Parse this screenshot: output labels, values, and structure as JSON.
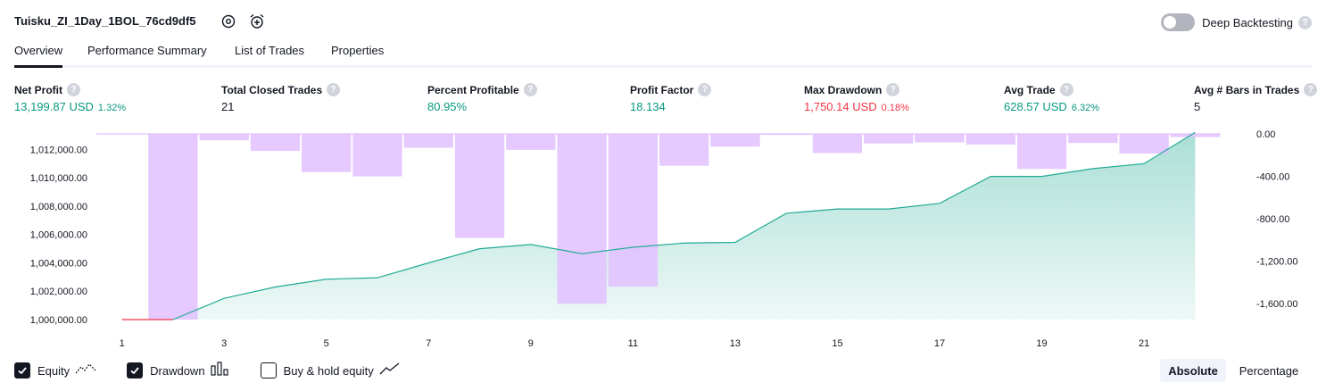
{
  "header": {
    "title": "Tuisku_ZI_1Day_1BOL_76cd9df5",
    "deep_backtesting_label": "Deep Backtesting",
    "help_mark": "?"
  },
  "tabs": [
    {
      "label": "Overview",
      "active": true
    },
    {
      "label": "Performance Summary",
      "active": false
    },
    {
      "label": "List of Trades",
      "active": false
    },
    {
      "label": "Properties",
      "active": false
    }
  ],
  "metrics": [
    {
      "label": "Net Profit",
      "value": "13,199.87 USD",
      "pct": "1.32%",
      "tone": "pos"
    },
    {
      "label": "Total Closed Trades",
      "value": "21",
      "pct": "",
      "tone": "neutral"
    },
    {
      "label": "Percent Profitable",
      "value": "80.95%",
      "pct": "",
      "tone": "pos"
    },
    {
      "label": "Profit Factor",
      "value": "18.134",
      "pct": "",
      "tone": "pos"
    },
    {
      "label": "Max Drawdown",
      "value": "1,750.14 USD",
      "pct": "0.18%",
      "tone": "neg"
    },
    {
      "label": "Avg Trade",
      "value": "628.57 USD",
      "pct": "6.32%",
      "tone": "pos"
    },
    {
      "label": "Avg # Bars in Trades",
      "value": "5",
      "pct": "",
      "tone": "neutral"
    }
  ],
  "legend": {
    "equity_label": "Equity",
    "drawdown_label": "Drawdown",
    "buyhold_label": "Buy & hold equity",
    "equity_checked": true,
    "drawdown_checked": true,
    "buyhold_checked": false
  },
  "modes": {
    "absolute": "Absolute",
    "percentage": "Percentage"
  },
  "colors": {
    "equity_line": "#22ab94",
    "equity_fill": "#22ab94",
    "drawdown_bar": "#e1c2ff",
    "initial_segment": "#f23645",
    "positive": "#089981",
    "negative": "#f23645"
  },
  "chart_data": {
    "type": "line",
    "x": [
      1,
      2,
      3,
      4,
      5,
      6,
      7,
      8,
      9,
      10,
      11,
      12,
      13,
      14,
      15,
      16,
      17,
      18,
      19,
      20,
      21,
      22
    ],
    "x_ticks": [
      "1",
      "3",
      "5",
      "7",
      "9",
      "11",
      "13",
      "15",
      "17",
      "19",
      "21"
    ],
    "y_left_ticks": [
      "1,000,000.00",
      "1,002,000.00",
      "1,004,000.00",
      "1,006,000.00",
      "1,008,000.00",
      "1,010,000.00",
      "1,012,000.00"
    ],
    "y_left_range": [
      1000000,
      1013100
    ],
    "y_right_ticks": [
      "0.00",
      "-400.00",
      "-800.00",
      "-1,200.00",
      "-1,600.00"
    ],
    "y_right_range": [
      0,
      -1750
    ],
    "series": [
      {
        "name": "Equity",
        "kind": "area",
        "values": [
          1000000,
          1000000,
          1001500,
          1002300,
          1002850,
          1002950,
          1004000,
          1005000,
          1005300,
          1004650,
          1005100,
          1005400,
          1005450,
          1007500,
          1007800,
          1007800,
          1008200,
          1010100,
          1010100,
          1010650,
          1011000,
          1013200
        ]
      },
      {
        "name": "Drawdown",
        "kind": "bar",
        "values": [
          0,
          -1750,
          -60,
          -160,
          -360,
          -400,
          -130,
          -980,
          -150,
          -1600,
          -1440,
          -300,
          -120,
          -10,
          -180,
          -90,
          -80,
          -100,
          -330,
          -85,
          -185,
          -30
        ]
      }
    ],
    "grid": false,
    "legend_position": "bottom-left"
  }
}
